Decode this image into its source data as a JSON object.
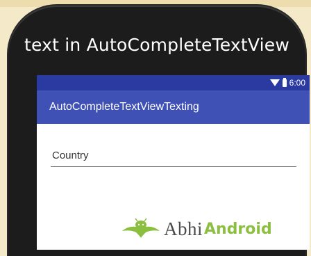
{
  "phone": {
    "title": "text in AutoCompleteTextView"
  },
  "status_bar": {
    "time": "6:00"
  },
  "app": {
    "title": "AutoCompleteTextViewTexting"
  },
  "form": {
    "country_placeholder": "Country",
    "country_value": ""
  },
  "watermark": {
    "part1": "Abhi",
    "part2": "Android"
  },
  "colors": {
    "status_bar": "#2a3aa0",
    "action_bar": "#3f51b5",
    "brand_green": "#8cbf3f"
  }
}
